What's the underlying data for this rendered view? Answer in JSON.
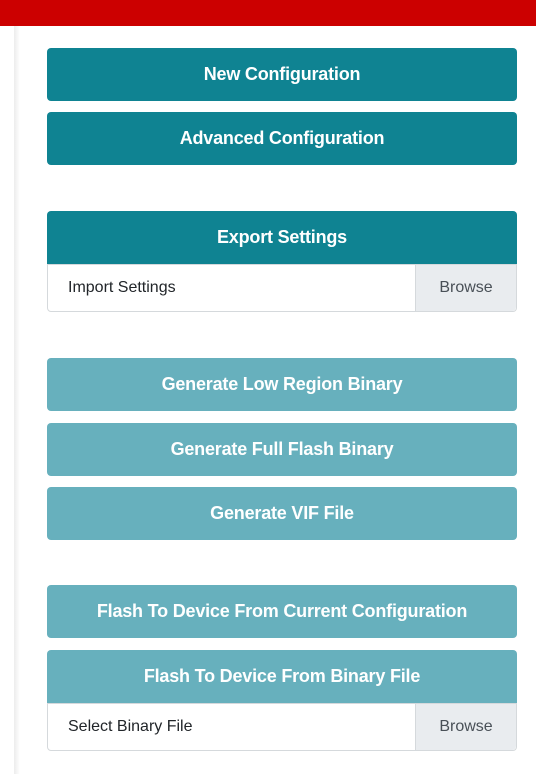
{
  "colors": {
    "top_bar": "#cc0000",
    "primary_button": "#0f8392",
    "disabled_button": "#67b0bd",
    "browse_bg": "#e9ecef"
  },
  "buttons": {
    "new_configuration": "New Configuration",
    "advanced_configuration": "Advanced Configuration",
    "export_settings": "Export Settings",
    "generate_low_region_binary": "Generate Low Region Binary",
    "generate_full_flash_binary": "Generate Full Flash Binary",
    "generate_vif_file": "Generate VIF File",
    "flash_from_current_configuration": "Flash To Device From Current Configuration",
    "flash_from_binary_file": "Flash To Device From Binary File"
  },
  "import_settings": {
    "label": "Import Settings",
    "browse": "Browse"
  },
  "select_binary_file": {
    "label": "Select Binary File",
    "browse": "Browse"
  }
}
